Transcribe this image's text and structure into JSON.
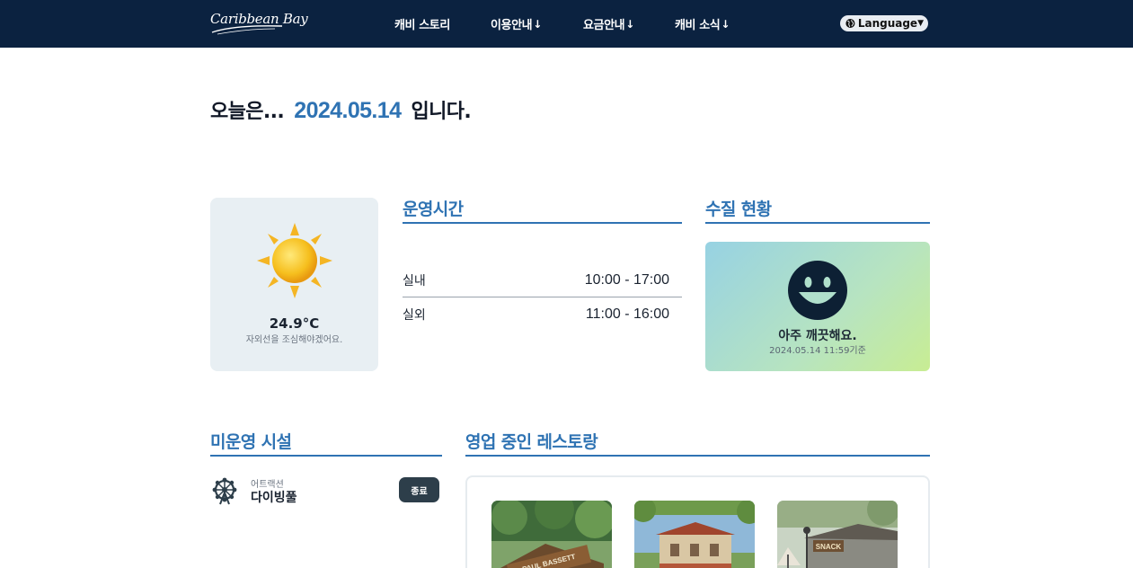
{
  "header": {
    "logo_text": "Caribbean Bay",
    "nav": [
      {
        "label": "캐비 스토리",
        "has_dropdown": false
      },
      {
        "label": "이용안내",
        "has_dropdown": true
      },
      {
        "label": "요금안내",
        "has_dropdown": true
      },
      {
        "label": "캐비 소식",
        "has_dropdown": true
      }
    ],
    "dropdown_arrow": "↓",
    "language_label": "Language",
    "colors": {
      "background": "#0b2240",
      "text": "#ffffff"
    }
  },
  "today": {
    "prefix": "오늘은...",
    "date": "2024.05.14",
    "suffix": "입니다."
  },
  "weather": {
    "icon": "sun-icon",
    "temperature": "24.9°C",
    "message": "자외선을 조심해야겠어요."
  },
  "hours": {
    "title": "운영시간",
    "rows": [
      {
        "label": "실내",
        "time": "10:00 - 17:00"
      },
      {
        "label": "실외",
        "time": "11:00 - 16:00"
      }
    ]
  },
  "water": {
    "title": "수질 현황",
    "icon": "smiley-icon",
    "status": "아주 깨끗해요.",
    "updated": "2024.05.14 11:59기준"
  },
  "closed_facilities": {
    "title": "미운영 시설",
    "items": [
      {
        "category": "어트랙션",
        "name": "다이빙풀",
        "status": "종료",
        "icon": "ferris-wheel-icon"
      }
    ]
  },
  "restaurants": {
    "title": "영업 중인 레스토랑",
    "items": [
      {
        "sign": "PAUL BASSETT"
      },
      {
        "sign": ""
      },
      {
        "sign": "SNACK"
      }
    ]
  },
  "accent_color": "#2f73b3"
}
